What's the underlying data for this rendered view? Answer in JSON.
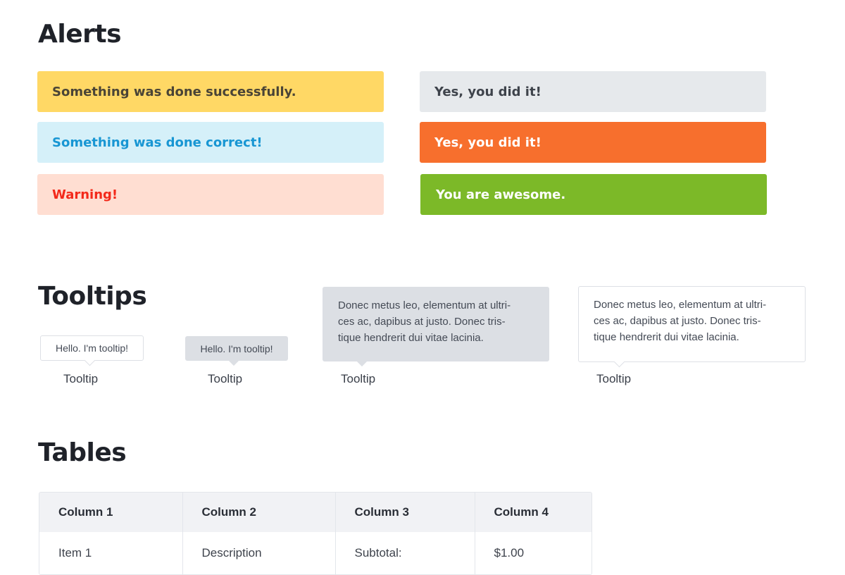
{
  "sections": {
    "alerts": "Alerts",
    "tooltips": "Tooltips",
    "tables": "Tables"
  },
  "alerts": [
    {
      "text": "Something was done successfully.",
      "bg": "#ffd865",
      "color": "#4a4436"
    },
    {
      "text": "Something was done correct!",
      "bg": "#d5f0f9",
      "color": "#1896d3"
    },
    {
      "text": "Warning!",
      "bg": "#ffded2",
      "color": "#f3291a"
    },
    {
      "text": "Yes, you did it!",
      "bg": "#e6e9ec",
      "color": "#3e434b"
    },
    {
      "text": "Yes, you did it!",
      "bg": "#f76f2d",
      "color": "#ffffff"
    },
    {
      "text": "You are awesome.",
      "bg": "#7cb928",
      "color": "#ffffff"
    }
  ],
  "tooltips": [
    {
      "text": "Hello. I'm tooltip!",
      "label": "Tooltip",
      "style": "white"
    },
    {
      "text": "Hello. I'm tooltip!",
      "label": "Tooltip",
      "style": "gray"
    },
    {
      "lines": [
        "Donec metus leo, elementum at ultri-",
        "ces ac, dapibus at justo. Donec tris-",
        "tique hendrerit dui vitae lacinia."
      ],
      "label": "Tooltip",
      "style": "gray"
    },
    {
      "lines": [
        "Donec metus leo, elementum at ultri-",
        "ces ac, dapibus at justo. Donec tris-",
        "tique hendrerit dui vitae lacinia."
      ],
      "label": "Tooltip",
      "style": "white"
    }
  ],
  "table": {
    "headers": [
      "Column 1",
      "Column 2",
      "Column 3",
      "Column 4"
    ],
    "rows": [
      [
        "Item 1",
        "Description",
        "Subtotal:",
        "$1.00"
      ]
    ]
  }
}
